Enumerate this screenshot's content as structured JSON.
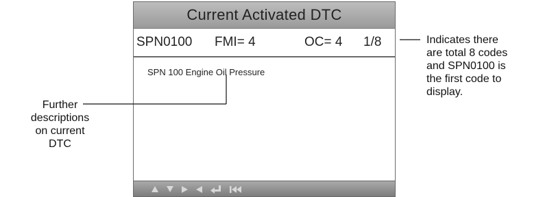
{
  "screen": {
    "title": "Current Activated DTC",
    "code": "SPN0100",
    "fmi": "FMI= 4",
    "oc": "OC= 4",
    "position": "1/8",
    "description": "SPN 100 Engine Oil Pressure",
    "footer_icons": [
      "up-arrow-icon",
      "down-arrow-icon",
      "right-arrow-icon",
      "left-arrow-icon",
      "enter-icon",
      "first-page-icon"
    ]
  },
  "annotations": {
    "right": [
      "Indicates there",
      "are total 8 codes",
      "and SPN0100 is",
      "the first code to",
      "display."
    ],
    "left": [
      "Further",
      "descriptions",
      "on current",
      "DTC"
    ]
  },
  "colors": {
    "title_bar": "#a9a9a9",
    "footer_bar": "#8a8a8a",
    "footer_icon": "#d8d8d8",
    "border": "#6a6a6a"
  }
}
